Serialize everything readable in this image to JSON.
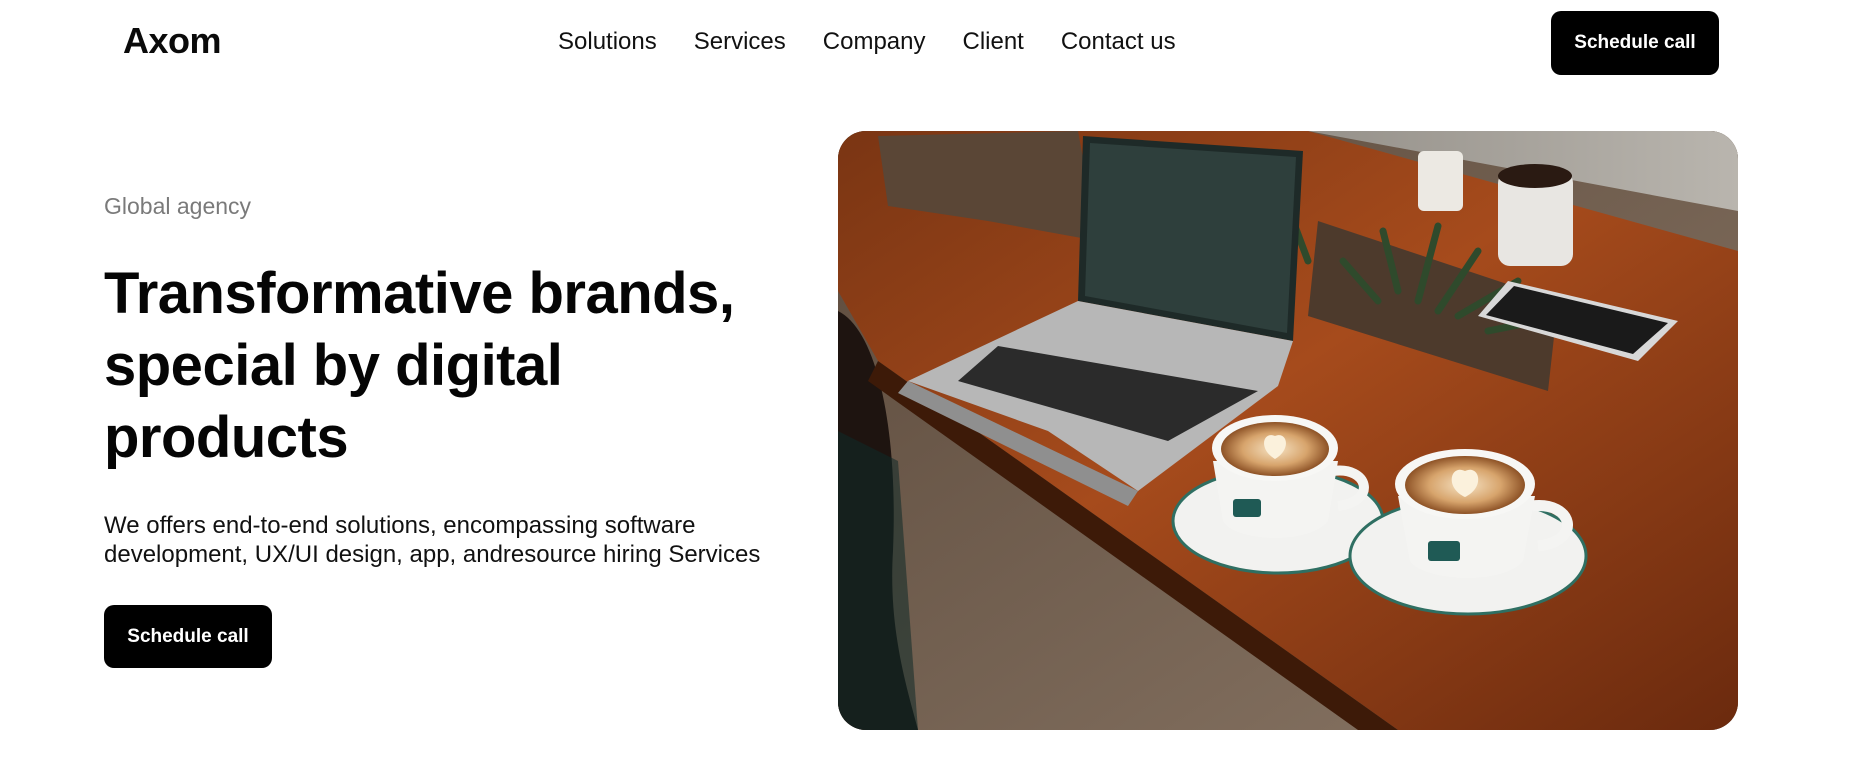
{
  "header": {
    "logo": "Axom",
    "nav": [
      "Solutions",
      "Services",
      "Company",
      "Client",
      "Contact us"
    ],
    "cta_label": "Schedule call"
  },
  "hero": {
    "eyebrow": "Global agency",
    "headline_lines": [
      "Transformative brands,",
      "special by digital",
      "products"
    ],
    "description_lines": [
      "We offers end-to-end solutions, encompassing software",
      "development, UX/UI design, app, andresource hiring Services"
    ],
    "cta_label": "Schedule call"
  },
  "colors": {
    "button_bg": "#000000",
    "button_text": "#ffffff",
    "eyebrow": "#7a7a7a"
  }
}
